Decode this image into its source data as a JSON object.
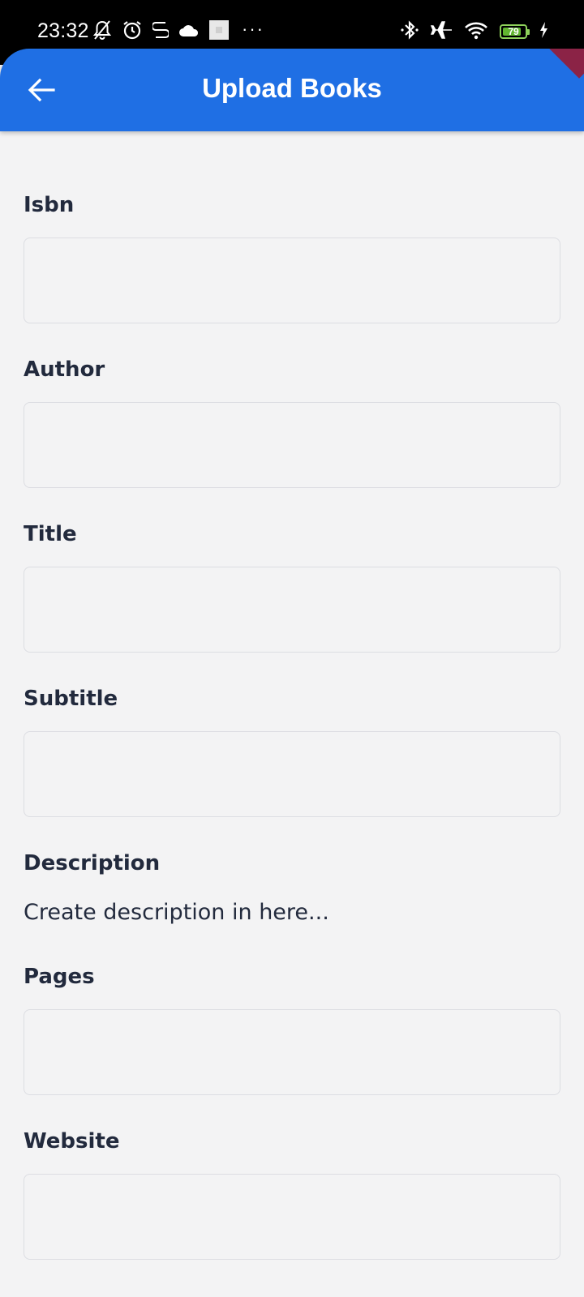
{
  "status_bar": {
    "time": "23:32",
    "battery_level": "79",
    "overflow": "···",
    "icons_left": [
      "bell-off-icon",
      "alarm-icon",
      "sim-icon",
      "cloud-icon",
      "image-icon"
    ],
    "icons_right": [
      "bluetooth-icon",
      "airplane-icon",
      "wifi-icon",
      "battery-icon",
      "charging-icon"
    ]
  },
  "app_bar": {
    "title": "Upload Books",
    "back_icon": "arrow-left-icon",
    "background": "#1f6fe4"
  },
  "form": {
    "fields": [
      {
        "label": "Isbn",
        "value": ""
      },
      {
        "label": "Author",
        "value": ""
      },
      {
        "label": "Title",
        "value": ""
      },
      {
        "label": "Subtitle",
        "value": ""
      },
      {
        "label": "Description",
        "placeholder": "Create description in here..."
      },
      {
        "label": "Pages",
        "value": ""
      },
      {
        "label": "Website",
        "value": ""
      }
    ]
  }
}
